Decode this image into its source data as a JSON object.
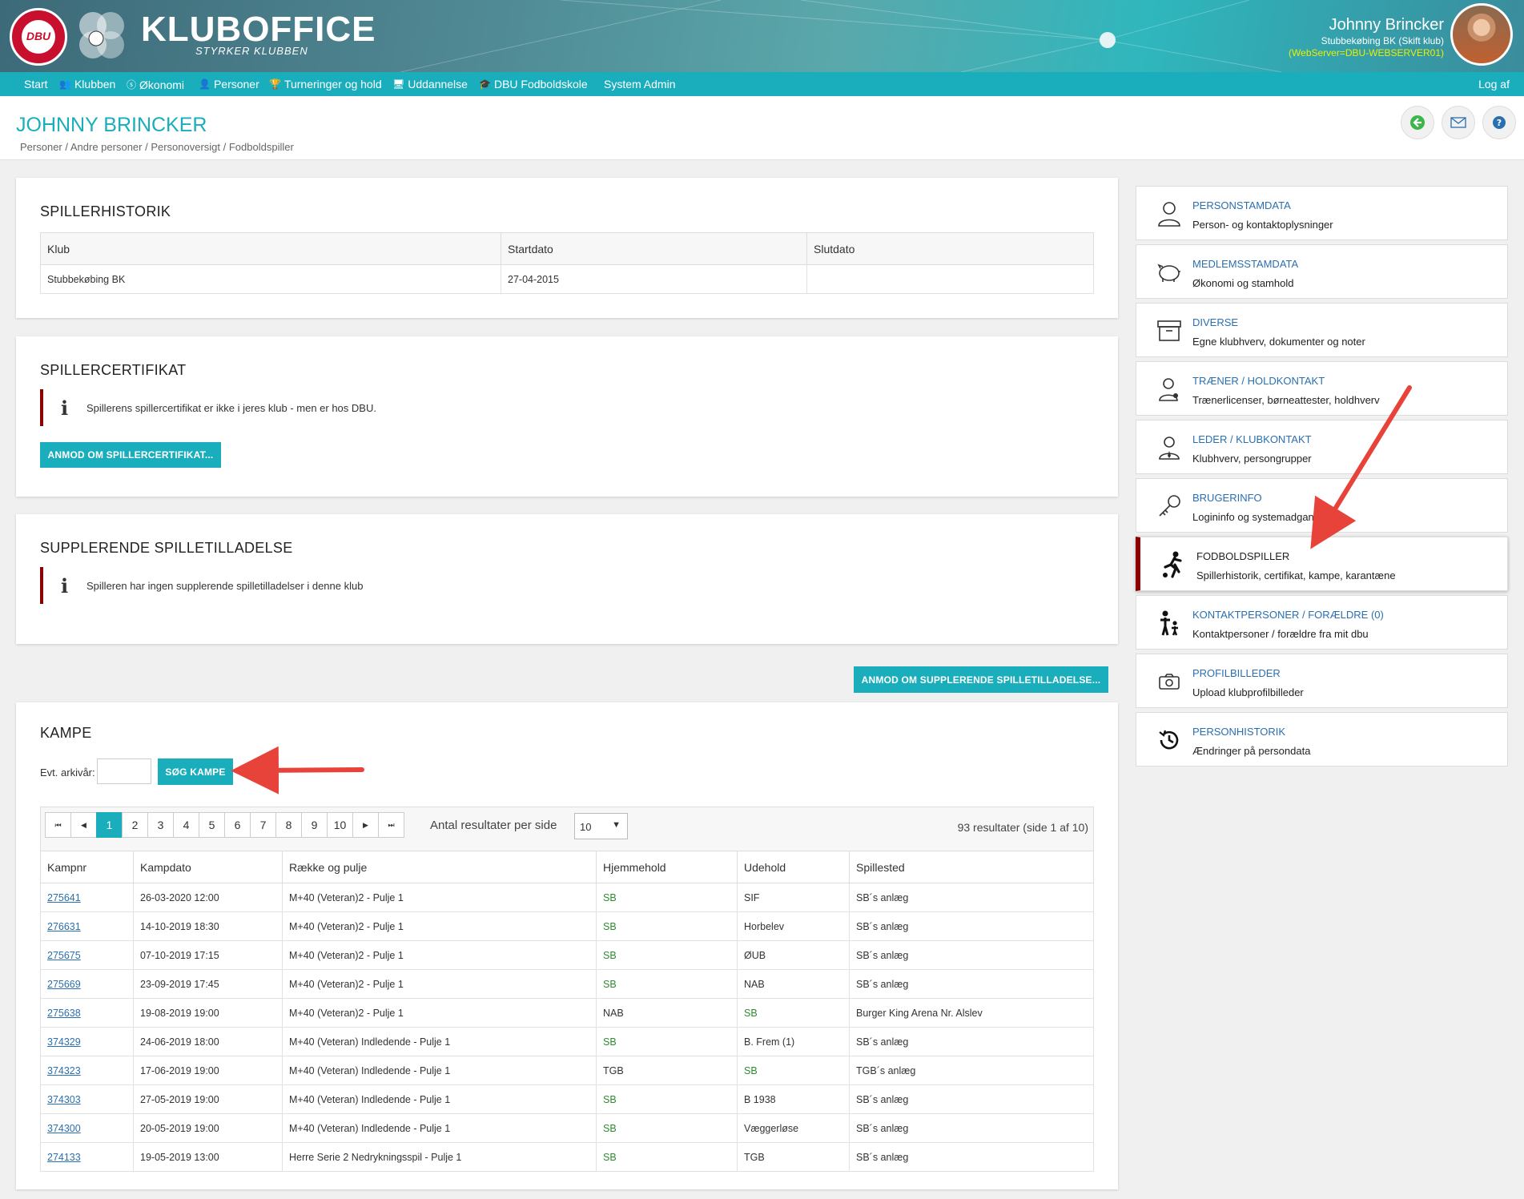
{
  "header": {
    "brand_logo_text": "DBU",
    "brand_title": "KLUBOFFICE",
    "brand_subtitle": "STYRKER KLUBBEN",
    "user_name": "Johnny Brincker",
    "user_club": "Stubbekøbing BK (Skift klub)",
    "server": "(WebServer=DBU-WEBSERVER01)"
  },
  "nav": {
    "items": [
      {
        "label": "Start",
        "icon": ""
      },
      {
        "label": "Klubben",
        "icon": "people-icon"
      },
      {
        "label": "Økonomi",
        "icon": "coin-icon"
      },
      {
        "label": "Personer",
        "icon": "person-icon"
      },
      {
        "label": "Turneringer og hold",
        "icon": "trophy-icon"
      },
      {
        "label": "Uddannelse",
        "icon": "screen-icon"
      },
      {
        "label": "DBU Fodboldskole",
        "icon": "cap-icon"
      },
      {
        "label": "System Admin",
        "icon": ""
      }
    ],
    "logout": "Log af"
  },
  "page": {
    "title": "JOHNNY BRINCKER",
    "breadcrumb": "Personer / Andre personer / Personoversigt / Fodboldspiller"
  },
  "spillerhistorik": {
    "title": "SPILLERHISTORIK",
    "columns": [
      "Klub",
      "Startdato",
      "Slutdato"
    ],
    "rows": [
      [
        "Stubbekøbing BK",
        "27-04-2015",
        ""
      ]
    ]
  },
  "spillercertifikat": {
    "title": "SPILLERCERTIFIKAT",
    "info": "Spillerens spillercertifikat er ikke i jeres klub - men er hos DBU.",
    "button": "ANMOD OM SPILLERCERTIFIKAT..."
  },
  "supplerende": {
    "title": "SUPPLERENDE SPILLETILLADELSE",
    "info": "Spilleren har ingen supplerende spilletilladelser i denne klub",
    "button": "ANMOD OM SUPPLERENDE SPILLETILLADELSE..."
  },
  "kampe": {
    "title": "KAMPE",
    "archive_label": "Evt. arkivår:",
    "archive_value": "",
    "search_button": "SØG KAMPE",
    "pages": [
      "1",
      "2",
      "3",
      "4",
      "5",
      "6",
      "7",
      "8",
      "9",
      "10"
    ],
    "active_page": "1",
    "per_page_label": "Antal resultater per side",
    "per_page_value": "10",
    "result_count": "93 resultater (side 1 af 10)",
    "columns": [
      "Kampnr",
      "Kampdato",
      "Række og pulje",
      "Hjemmehold",
      "Udehold",
      "Spillested"
    ],
    "rows": [
      {
        "nr": "275641",
        "dato": "26-03-2020 12:00",
        "pulje": "M+40 (Veteran)2 - Pulje 1",
        "hjemme": "SB",
        "ude": "SIF",
        "sted": "SB´s anlæg",
        "own": "hjemme"
      },
      {
        "nr": "276631",
        "dato": "14-10-2019 18:30",
        "pulje": "M+40 (Veteran)2 - Pulje 1",
        "hjemme": "SB",
        "ude": "Horbelev",
        "sted": "SB´s anlæg",
        "own": "hjemme"
      },
      {
        "nr": "275675",
        "dato": "07-10-2019 17:15",
        "pulje": "M+40 (Veteran)2 - Pulje 1",
        "hjemme": "SB",
        "ude": "ØUB",
        "sted": "SB´s anlæg",
        "own": "hjemme"
      },
      {
        "nr": "275669",
        "dato": "23-09-2019 17:45",
        "pulje": "M+40 (Veteran)2 - Pulje 1",
        "hjemme": "SB",
        "ude": "NAB",
        "sted": "SB´s anlæg",
        "own": "hjemme"
      },
      {
        "nr": "275638",
        "dato": "19-08-2019 19:00",
        "pulje": "M+40 (Veteran)2 - Pulje 1",
        "hjemme": "NAB",
        "ude": "SB",
        "sted": "Burger King Arena Nr. Alslev",
        "own": "ude"
      },
      {
        "nr": "374329",
        "dato": "24-06-2019 18:00",
        "pulje": "M+40 (Veteran) Indledende - Pulje 1",
        "hjemme": "SB",
        "ude": "B. Frem (1)",
        "sted": "SB´s anlæg",
        "own": "hjemme"
      },
      {
        "nr": "374323",
        "dato": "17-06-2019 19:00",
        "pulje": "M+40 (Veteran) Indledende - Pulje 1",
        "hjemme": "TGB",
        "ude": "SB",
        "sted": "TGB´s anlæg",
        "own": "ude"
      },
      {
        "nr": "374303",
        "dato": "27-05-2019 19:00",
        "pulje": "M+40 (Veteran) Indledende - Pulje 1",
        "hjemme": "SB",
        "ude": "B 1938",
        "sted": "SB´s anlæg",
        "own": "hjemme"
      },
      {
        "nr": "374300",
        "dato": "20-05-2019 19:00",
        "pulje": "M+40 (Veteran) Indledende - Pulje 1",
        "hjemme": "SB",
        "ude": "Væggerløse",
        "sted": "SB´s anlæg",
        "own": "hjemme"
      },
      {
        "nr": "274133",
        "dato": "19-05-2019 13:00",
        "pulje": "Herre Serie 2 Nedrykningsspil - Pulje 1",
        "hjemme": "SB",
        "ude": "TGB",
        "sted": "SB´s anlæg",
        "own": "hjemme"
      }
    ]
  },
  "sidebar": {
    "items": [
      {
        "title": "PERSONSTAMDATA",
        "desc": "Person- og kontaktoplysninger",
        "icon": "person-outline-icon"
      },
      {
        "title": "MEDLEMSSTAMDATA",
        "desc": "Økonomi og stamhold",
        "icon": "piggy-bank-icon"
      },
      {
        "title": "DIVERSE",
        "desc": "Egne klubhverv, dokumenter og noter",
        "icon": "archive-box-icon"
      },
      {
        "title": "TRÆNER / HOLDKONTAKT",
        "desc": "Trænerlicenser, børneattester, holdhverv",
        "icon": "coach-icon"
      },
      {
        "title": "LEDER / KLUBKONTAKT",
        "desc": "Klubhverv, persongrupper",
        "icon": "leader-icon"
      },
      {
        "title": "BRUGERINFO",
        "desc": "Logininfo og systemadgange",
        "icon": "key-icon"
      },
      {
        "title": "FODBOLDSPILLER",
        "desc": "Spillerhistorik, certifikat, kampe, karantæne",
        "icon": "football-player-icon",
        "active": true
      },
      {
        "title": "KONTAKTPERSONER / FORÆLDRE (0)",
        "desc": "Kontaktpersoner / forældre fra mit dbu",
        "icon": "parent-child-icon"
      },
      {
        "title": "PROFILBILLEDER",
        "desc": "Upload klubprofilbilleder",
        "icon": "camera-icon"
      },
      {
        "title": "PERSONHISTORIK",
        "desc": "Ændringer på persondata",
        "icon": "history-icon"
      }
    ]
  },
  "colors": {
    "accent": "#1aaebd",
    "link": "#2a6fb0",
    "active_border": "#8b0000",
    "annotation_arrow": "#e8433b"
  }
}
